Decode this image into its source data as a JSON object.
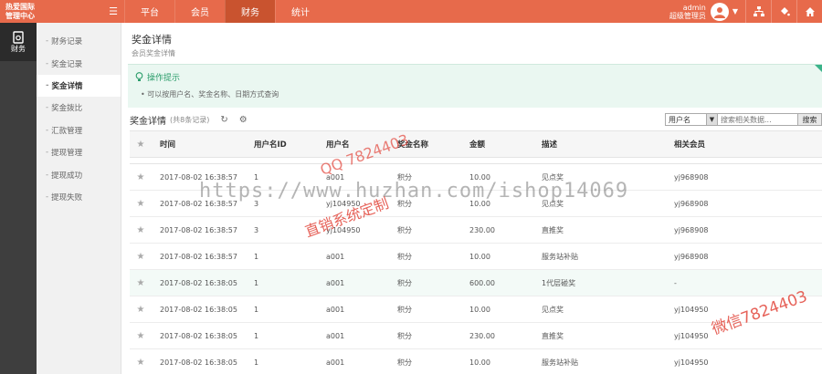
{
  "brand": {
    "line1": "热爱国际",
    "line2": "管理中心"
  },
  "nav": [
    {
      "label": "平台"
    },
    {
      "label": "会员"
    },
    {
      "label": "财务"
    },
    {
      "label": "统计"
    }
  ],
  "user": {
    "name": "admin",
    "role": "超级管理员"
  },
  "rail": {
    "label": "财务"
  },
  "submenu": [
    {
      "label": "财务记录"
    },
    {
      "label": "奖金记录"
    },
    {
      "label": "奖金详情"
    },
    {
      "label": "奖金拨比"
    },
    {
      "label": "汇款管理"
    },
    {
      "label": "提现管理"
    },
    {
      "label": "提现成功"
    },
    {
      "label": "提现失败"
    }
  ],
  "page": {
    "title": "奖金详情",
    "subtitle": "会员奖金详情"
  },
  "tips": {
    "title": "操作提示",
    "line": "可以按用户名、奖金名称、日期方式查询"
  },
  "toolbar": {
    "title": "奖金详情",
    "count": "(共8条记录)",
    "select_value": "用户名",
    "search_placeholder": "搜索相关数据...",
    "search_label": "搜索"
  },
  "table": {
    "headers": [
      "时间",
      "用户名ID",
      "用户名",
      "奖金名称",
      "金额",
      "描述",
      "相关会员"
    ],
    "rows": [
      [
        "2017-08-02 16:38:57",
        "1",
        "a001",
        "积分",
        "10.00",
        "见点奖",
        "yj968908"
      ],
      [
        "2017-08-02 16:38:57",
        "3",
        "yj104950",
        "积分",
        "10.00",
        "见点奖",
        "yj968908"
      ],
      [
        "2017-08-02 16:38:57",
        "3",
        "yj104950",
        "积分",
        "230.00",
        "直推奖",
        "yj968908"
      ],
      [
        "2017-08-02 16:38:57",
        "1",
        "a001",
        "积分",
        "10.00",
        "服务站补贴",
        "yj968908"
      ],
      [
        "2017-08-02 16:38:05",
        "1",
        "a001",
        "积分",
        "600.00",
        "1代层碰奖",
        "-"
      ],
      [
        "2017-08-02 16:38:05",
        "1",
        "a001",
        "积分",
        "10.00",
        "见点奖",
        "yj104950"
      ],
      [
        "2017-08-02 16:38:05",
        "1",
        "a001",
        "积分",
        "230.00",
        "直推奖",
        "yj104950"
      ],
      [
        "2017-08-02 16:38:05",
        "1",
        "a001",
        "积分",
        "10.00",
        "服务站补贴",
        "yj104950"
      ]
    ]
  },
  "watermark": {
    "url": "https://www.huzhan.com/ishop14069",
    "qq": "QQ 7824403",
    "red1": "直销系统定制",
    "red2": "微信7824403"
  },
  "colors": {
    "topbar": "#e76a4b",
    "nav_active": "#c9532f",
    "rail": "#3e3e3e",
    "tips_bg": "#eaf7f1",
    "tips_text": "#2a9c6a"
  }
}
